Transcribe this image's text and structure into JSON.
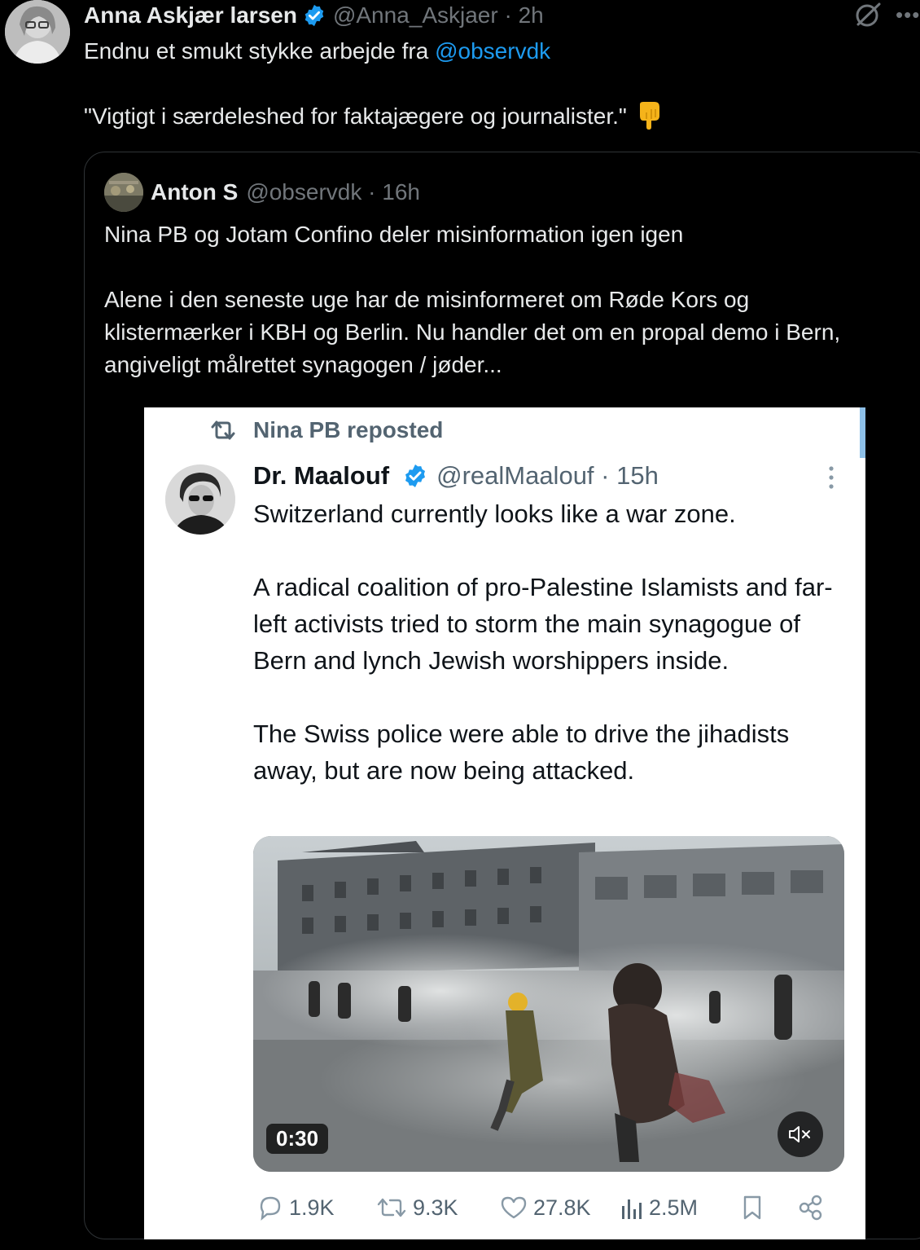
{
  "outer_tweet": {
    "name": "Anna Askjær larsen",
    "handle": "@Anna_Askjaer",
    "time": "2h",
    "text_prefix": "Endnu et smukt stykke arbejde fra ",
    "mention": "@observdk",
    "quote_line": "\"Vigtigt i særdeleshed for faktajægere og journalister.\""
  },
  "quoted_tweet": {
    "name": "Anton S",
    "handle": "@observdk",
    "time": "16h",
    "line1": "Nina PB og Jotam Confino deler misinformation igen igen",
    "line2": "Alene i den seneste uge har de misinformeret om Røde Kors og klistermærker i KBH og Berlin. Nu handler det om en propal demo i Bern, angiveligt målrettet synagogen / jøder..."
  },
  "embedded_screenshot": {
    "repost_label": "Nina PB reposted",
    "name": "Dr. Maalouf",
    "handle": "@realMaalouf",
    "time": "15h",
    "paragraph1": "Switzerland currently looks like a war zone.",
    "paragraph2": "A radical coalition of pro-Palestine Islamists and far-left activists tried to storm the main synagogue of Bern and lynch Jewish worshippers inside.",
    "paragraph3": "The Swiss police were able to drive the jihadists away, but are now being attacked.",
    "video_duration": "0:30",
    "stats": {
      "replies": "1.9K",
      "reposts": "9.3K",
      "likes": "27.8K",
      "views": "2.5M"
    }
  },
  "colors": {
    "background": "#000000",
    "text": "#e7e9ea",
    "muted": "#71767b",
    "accent": "#1d9bf0",
    "verified": "#1d9bf0",
    "card_border": "#2f3336"
  },
  "icons": {
    "verified": "verified-badge-icon",
    "grok": "grok-icon",
    "more": "more-icon",
    "point_down": "backhand-index-pointing-down-icon",
    "repost": "repost-icon",
    "kebab": "kebab-icon",
    "mute": "mute-icon",
    "reply": "reply-icon",
    "like": "like-icon",
    "views": "views-icon",
    "bookmark": "bookmark-icon",
    "share": "share-icon"
  }
}
